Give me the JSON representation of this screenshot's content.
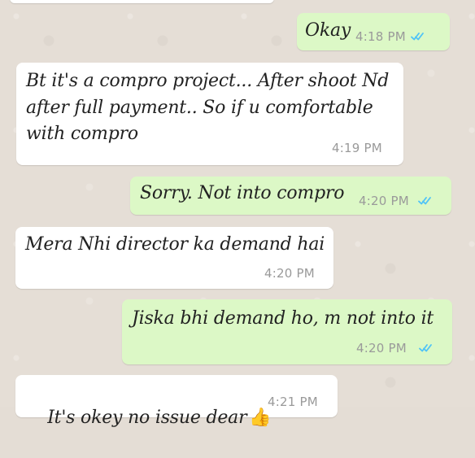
{
  "messages": [
    {
      "id": "m1",
      "type": "outgoing",
      "text": "Okay",
      "time": "4:18 PM",
      "ticks": "read"
    },
    {
      "id": "m2",
      "type": "incoming",
      "text": "Bt it's a compro project... After shoot Nd\nafter full payment.. So if u comfortable\nwith compro",
      "time": "4:19 PM"
    },
    {
      "id": "m3",
      "type": "outgoing",
      "text": "Sorry. Not into compro",
      "time": "4:20 PM",
      "ticks": "read"
    },
    {
      "id": "m4",
      "type": "incoming",
      "text": "Mera Nhi director ka demand hai",
      "time": "4:20 PM"
    },
    {
      "id": "m5",
      "type": "outgoing",
      "text": "Jiska bhi demand ho, m not into it",
      "time": "4:20 PM",
      "ticks": "read"
    },
    {
      "id": "m6",
      "type": "incoming",
      "text": "It's okey no issue dear",
      "emoji": "👍",
      "time": "4:21 PM"
    }
  ],
  "colors": {
    "incoming": "#ffffff",
    "outgoing": "#dcf8c6",
    "tick": "#4fc3f7"
  }
}
